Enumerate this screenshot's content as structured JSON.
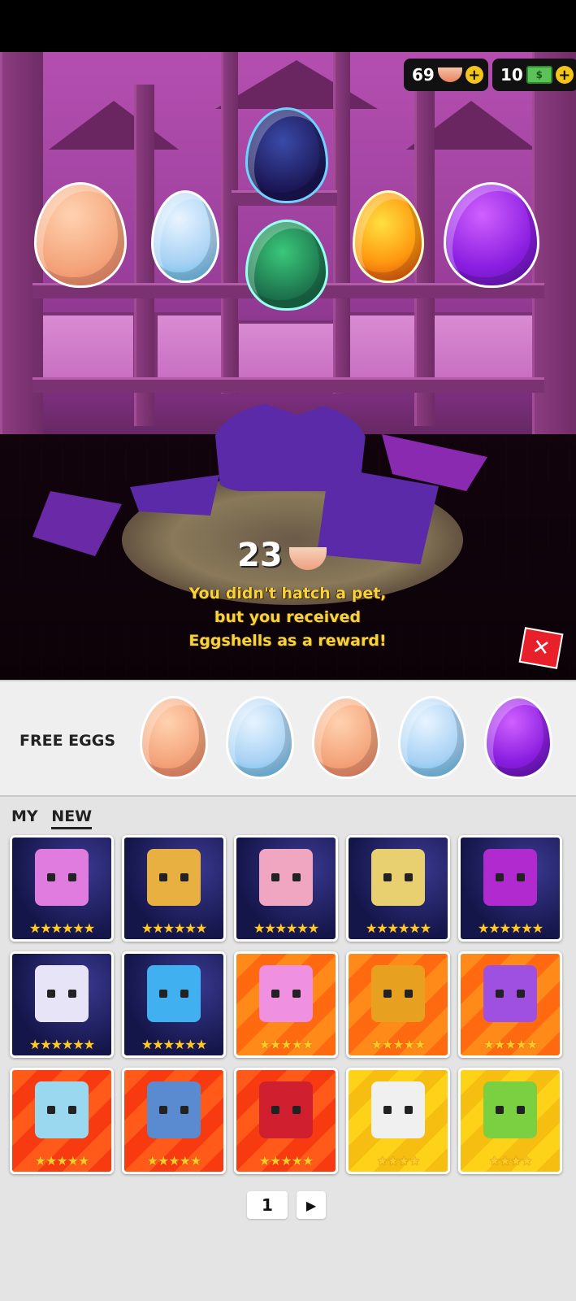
{
  "hud": {
    "eggshells": "69",
    "cash": "10",
    "cash_icon_glyph": "$"
  },
  "reward": {
    "count": "23",
    "message_line1": "You didn't hatch a pet,",
    "message_line2": "but you received",
    "message_line3": "Eggshells as a reward!"
  },
  "close_glyph": "✕",
  "free_eggs": {
    "label": "FREE EGGS",
    "eggs": [
      "peach",
      "blue",
      "peach",
      "blue",
      "purple"
    ]
  },
  "collection": {
    "tab_my": "MY",
    "tab_new": "NEW"
  },
  "pets": [
    {
      "rarity": "space",
      "stars": "★★★★★★",
      "icon": "pink-dragon-pet-icon",
      "color": "#e07ce0"
    },
    {
      "rarity": "space",
      "stars": "★★★★★★",
      "icon": "bee-king-pet-icon",
      "color": "#e8b040"
    },
    {
      "rarity": "space",
      "stars": "★★★★★★",
      "icon": "brain-robot-pet-icon",
      "color": "#f0a6c0"
    },
    {
      "rarity": "space",
      "stars": "★★★★★★",
      "icon": "money-lion-pet-icon",
      "color": "#e8d070"
    },
    {
      "rarity": "space",
      "stars": "★★★★★★",
      "icon": "purple-octopus-pet-icon",
      "color": "#b02ad0"
    },
    {
      "rarity": "space",
      "stars": "★★★★★★",
      "icon": "white-fox-pet-icon",
      "color": "#e8e4f8"
    },
    {
      "rarity": "space",
      "stars": "★★★★★★",
      "icon": "rainbow-dog-pet-icon",
      "color": "#40b0f0"
    },
    {
      "rarity": "orange",
      "stars": "★★★★★",
      "icon": "pink-jelly-cube-pet-icon",
      "color": "#f090e0"
    },
    {
      "rarity": "orange",
      "stars": "★★★★★",
      "icon": "lava-block-pet-icon",
      "color": "#e8a020"
    },
    {
      "rarity": "orange",
      "stars": "★★★★★",
      "icon": "winged-eye-pet-icon",
      "color": "#a050e0"
    },
    {
      "rarity": "red",
      "stars": "★★★★★",
      "icon": "ice-cube-chick-pet-icon",
      "color": "#9ad8f0"
    },
    {
      "rarity": "red",
      "stars": "★★★★★",
      "icon": "backpack-chick-pet-icon",
      "color": "#5a8ad0"
    },
    {
      "rarity": "red",
      "stars": "★★★★★",
      "icon": "caped-hero-pet-icon",
      "color": "#d02030"
    },
    {
      "rarity": "yellow",
      "stars": "★★★★",
      "icon": "white-hair-girl-pet-icon",
      "color": "#f0f0f0"
    },
    {
      "rarity": "yellow",
      "stars": "★★★★",
      "icon": "green-bug-pet-icon",
      "color": "#7ad040"
    }
  ],
  "pager": {
    "page": "1",
    "next_glyph": "▶"
  },
  "colors": {
    "reward_text": "#f6d33a",
    "close_button": "#e8202a",
    "star": "#ffc92a"
  }
}
